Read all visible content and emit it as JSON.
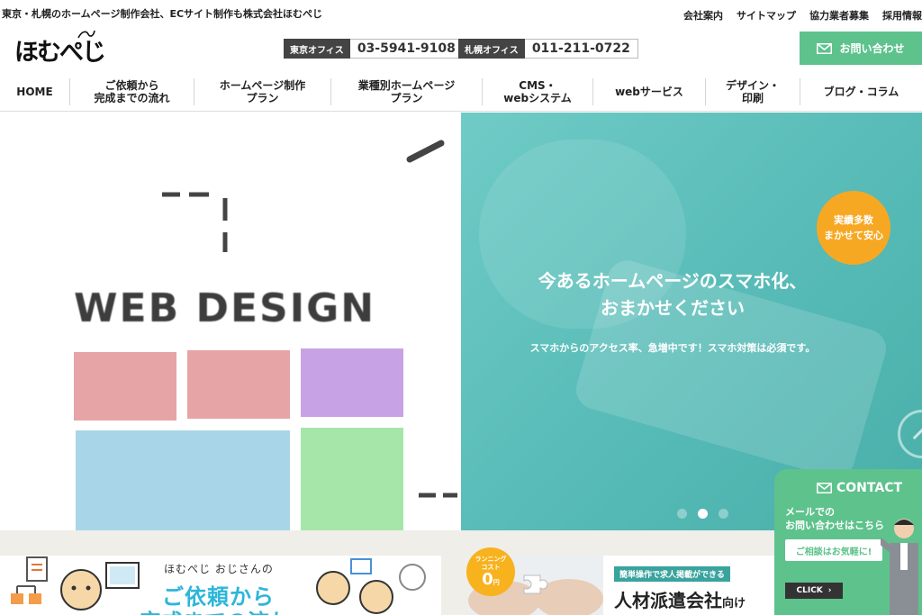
{
  "header": {
    "tagline": "東京・札幌のホームページ制作会社、ECサイト制作も株式会社ほむぺじ",
    "top_links": [
      "会社案内",
      "サイトマップ",
      "協力業者募集",
      "採用情報"
    ],
    "logo_text": "ほむぺじ",
    "offices": [
      {
        "label": "東京オフィス",
        "phone": "03-5941-9108"
      },
      {
        "label": "札幌オフィス",
        "phone": "011-211-0722"
      }
    ],
    "contact_button": "お問い合わせ"
  },
  "nav": [
    {
      "line1": "HOME",
      "line2": ""
    },
    {
      "line1": "ご依頼から",
      "line2": "完成までの流れ"
    },
    {
      "line1": "ホームページ制作",
      "line2": "プラン"
    },
    {
      "line1": "業種別ホームページ",
      "line2": "プラン"
    },
    {
      "line1": "CMS・",
      "line2": "webシステム"
    },
    {
      "line1": "webサービス",
      "line2": ""
    },
    {
      "line1": "デザイン・",
      "line2": "印刷"
    },
    {
      "line1": "ブログ・コラム",
      "line2": ""
    }
  ],
  "hero": {
    "left_title": "WEB DESIGN",
    "headline_1": "今あるホームページのスマホ化、",
    "headline_2": "おまかせください",
    "subtext": "スマホからのアクセス率、急増中です！スマホ対策は必須です。",
    "badge_1": "実績多数",
    "badge_2": "まかせて安心",
    "slide_count": 3,
    "active_slide": 2,
    "colors": {
      "teal": "#5fc1bd",
      "badge": "#f7a823"
    }
  },
  "banners": {
    "flow_title": "ほむぺじ おじさんの",
    "flow_main": "ご依頼から",
    "flow_main2": "完成までの流れ",
    "running_cost_1": "ランニング",
    "running_cost_2": "コスト",
    "running_cost_zero": "0",
    "running_cost_unit": "円",
    "recruit_tag": "簡単操作で求人掲載ができる",
    "recruit_main": "人材派遣会社",
    "recruit_suffix": "向け"
  },
  "contact_panel": {
    "title": "CONTACT",
    "line1": "メールでの",
    "line2": "お問い合わせはこちら",
    "consult": "ご相談はお気軽に!",
    "click": "CLICK",
    "accent": "#5ec28c"
  }
}
